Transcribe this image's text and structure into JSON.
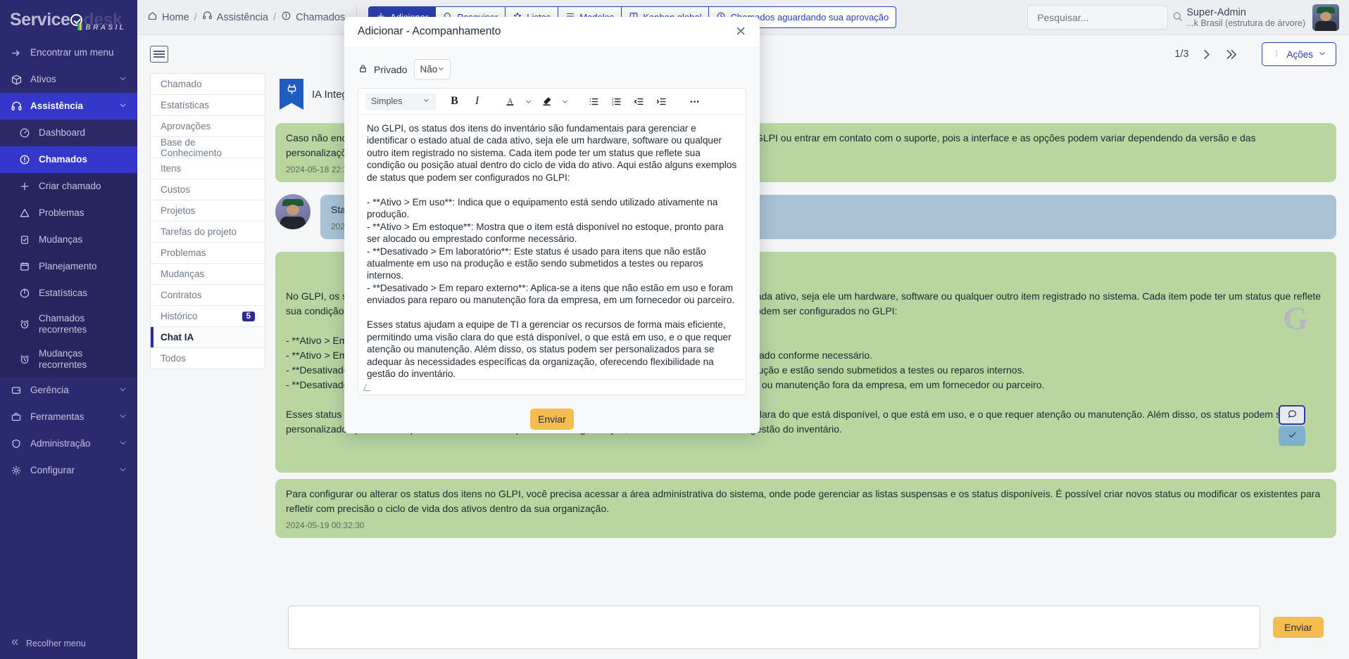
{
  "sidebar": {
    "brand": {
      "part1": "Service",
      "part2": "desk",
      "sub": "BRASIL"
    },
    "find_menu": "Encontrar um menu",
    "groups": [
      {
        "label": "Ativos",
        "icon": "box-icon"
      },
      {
        "label": "Assistência",
        "icon": "headset-icon"
      }
    ],
    "assistance_items": [
      {
        "label": "Dashboard",
        "icon": "gauge-icon"
      },
      {
        "label": "Chamados",
        "icon": "alert-circle-icon"
      },
      {
        "label": "Criar chamado",
        "icon": "plus-icon"
      },
      {
        "label": "Problemas",
        "icon": "warning-triangle-icon"
      },
      {
        "label": "Mudanças",
        "icon": "clipboard-check-icon"
      },
      {
        "label": "Planejamento",
        "icon": "calendar-icon"
      },
      {
        "label": "Estatísticas",
        "icon": "pie-chart-icon"
      },
      {
        "label": "Chamados recorrentes",
        "icon": "alarm-clock-icon"
      },
      {
        "label": "Mudanças recorrentes",
        "icon": "alarm-clock-icon"
      }
    ],
    "bottom_groups": [
      {
        "label": "Gerência",
        "icon": "wallet-icon"
      },
      {
        "label": "Ferramentas",
        "icon": "briefcase-icon"
      },
      {
        "label": "Administração",
        "icon": "shield-icon"
      },
      {
        "label": "Configurar",
        "icon": "gear-icon"
      }
    ],
    "collapse": "Recolher menu"
  },
  "topbar": {
    "breadcrumb": [
      {
        "label": "Home",
        "icon": "home-icon"
      },
      {
        "label": "Assistência",
        "icon": "headset-icon"
      },
      {
        "label": "Chamados",
        "icon": "alert-circle-icon"
      }
    ],
    "buttons": [
      {
        "label": "Adicionar",
        "icon": "plus-icon",
        "primary": true
      },
      {
        "label": "Pesquisar",
        "icon": "search-icon",
        "primary": false
      },
      {
        "label": "Listas",
        "icon": "star-icon",
        "primary": false
      },
      {
        "label": "Modelos",
        "icon": "template-icon",
        "primary": false
      },
      {
        "label": "Kanban global",
        "icon": "kanban-icon",
        "primary": false
      },
      {
        "label": "Chamados aguardando sua aprovação",
        "icon": "clock-icon",
        "primary": false
      }
    ],
    "search_placeholder": "Pesquisar...",
    "search_value": "",
    "user_name": "Super-Admin",
    "user_entity": "...k Brasil (estrutura de árvore)"
  },
  "page": {
    "list_view_icon": "list-view-icon",
    "pagination": "1/3",
    "next_icon": "chevron-right-icon",
    "last_icon": "chevrons-right-icon",
    "actions_label": "Ações",
    "actions_icon": "dots-vertical-icon"
  },
  "subnav": {
    "items": [
      {
        "label": "Chamado"
      },
      {
        "label": "Estatísticas"
      },
      {
        "label": "Aprovações"
      },
      {
        "label": "Base de Conhecimento"
      },
      {
        "label": "Itens"
      },
      {
        "label": "Custos"
      },
      {
        "label": "Projetos"
      },
      {
        "label": "Tarefas do projeto"
      },
      {
        "label": "Problemas"
      },
      {
        "label": "Mudanças"
      },
      {
        "label": "Contratos"
      },
      {
        "label": "Histórico",
        "badge": "5"
      },
      {
        "label": "Chat IA",
        "active": true
      },
      {
        "label": "Todos"
      }
    ]
  },
  "chat": {
    "header_title": "IA Integração",
    "header_icon": "plug-flag-icon",
    "messages": [
      {
        "type": "green",
        "text": "Caso não encontre a opção desejada, pode ser útil consultar a documentação específica da sua versão do GLPI ou entrar em contato com o suporte, pois a interface e as opções podem variar dependendo da versão e das personalizações implementadas.",
        "time": "2024-05-18 22:36:40"
      },
      {
        "type": "blue",
        "text": "Status de itens do inventário",
        "time": "2024-05-19 00:32:11",
        "avatar": "user-avatar"
      },
      {
        "type": "green",
        "text": "No GLPI, os status dos itens do inventário são fundamentais para gerenciar e identificar o estado atual de cada ativo, seja ele um hardware, software ou qualquer outro item registrado no sistema. Cada item pode ter um status que reflete sua condição ou posição atual dentro do ciclo de vida do ativo. Aqui estão alguns exemplos de status que podem ser configurados no GLPI:\n\n- **Ativo > Em uso**: Indica que o equipamento está sendo utilizado ativamente na produção.\n- **Ativo > Em estoque**: Mostra que o item está disponível no estoque, pronto para ser alocado ou emprestado conforme necessário.\n- **Desativado > Em laboratório**: Este status é usado para itens que não estão atualmente em uso na produção e estão sendo submetidos a testes ou reparos internos.\n- **Desativado > Em reparo externo**: Aplica-se a itens que não estão em uso e foram enviados para reparo ou manutenção fora da empresa, em um fornecedor ou parceiro.\n\nEsses status ajudam a equipe de TI a gerenciar os recursos de forma mais eficiente, permitindo uma visão clara do que está disponível, o que está em uso, e o que requer atenção ou manutenção. Além disso, os status podem ser personalizados para se adequar às necessidades específicas da organização, oferecendo flexibilidade na gestão do inventário.",
        "time": ""
      },
      {
        "type": "green",
        "text": "Para configurar ou alterar os status dos itens no GLPI, você precisa acessar a área administrativa do sistema, onde pode gerenciar as listas suspensas e os status disponíveis. É possível criar novos status ou modificar os existentes para refletir com precisão o ciclo de vida dos ativos dentro da sua organização.",
        "time": "2024-05-19 00:32:30"
      }
    ],
    "watermark": "G",
    "float_buttons": [
      {
        "icon": "comment-icon",
        "name": "comment-action"
      },
      {
        "icon": "check-icon",
        "name": "validate-action"
      }
    ],
    "input_placeholder": "",
    "input_value": "",
    "send_label": "Enviar"
  },
  "modal": {
    "title": "Adicionar - Acompanhamento",
    "close_icon": "close-icon",
    "private_label": "Privado",
    "private_icon": "lock-icon",
    "private_value": "Não",
    "editor": {
      "style_value": "Simples",
      "toolbar": [
        {
          "name": "bold-button",
          "glyph": "B"
        },
        {
          "name": "italic-button",
          "glyph": "I"
        },
        {
          "name": "font-color-button",
          "glyph": "A"
        },
        {
          "name": "highlight-color-button",
          "glyph": "pen"
        },
        {
          "name": "bullet-list-button",
          "glyph": "ul"
        },
        {
          "name": "numbered-list-button",
          "glyph": "ol"
        },
        {
          "name": "outdent-button",
          "glyph": "outdent"
        },
        {
          "name": "indent-button",
          "glyph": "indent"
        },
        {
          "name": "more-options-button",
          "glyph": "..."
        }
      ],
      "content": "No GLPI, os status dos itens do inventário são fundamentais para gerenciar e identificar o estado atual de cada ativo, seja ele um hardware, software ou qualquer outro item registrado no sistema. Cada item pode ter um status que reflete sua condição ou posição atual dentro do ciclo de vida do ativo. Aqui estão alguns exemplos de status que podem ser configurados no GLPI:\n\n- **Ativo > Em uso**: Indica que o equipamento está sendo utilizado ativamente na produção.\n- **Ativo > Em estoque**: Mostra que o item está disponível no estoque, pronto para ser alocado ou emprestado conforme necessário.\n- **Desativado > Em laboratório**: Este status é usado para itens que não estão atualmente em uso na produção e estão sendo submetidos a testes ou reparos internos.\n- **Desativado > Em reparo externo**: Aplica-se a itens que não estão em uso e foram enviados para reparo ou manutenção fora da empresa, em um fornecedor ou parceiro.\n\nEsses status ajudam a equipe de TI a gerenciar os recursos de forma mais eficiente, permitindo uma visão clara do que está disponível, o que está em uso, e o que requer atenção ou manutenção. Além disso, os status podem ser personalizados para se adequar às necessidades específicas da organização, oferecendo flexibilidade na gestão do inventário.\n\nPara configurar ou alterar os status dos itens no GLPI, você precisa acessar a área administrativa do sistema, onde pode gerenciar as listas suspensas e os status disponíveis. É possível criar novos status ou modificar os existentes para refletir com precisão o ciclo de vida dos ativos dentro da sua organização."
    },
    "send_label": "Enviar"
  },
  "colors": {
    "sidebar_bg": "#2c2a6e",
    "sidebar_active": "#3437c9",
    "accent_blue": "#2c3dae",
    "send_yellow": "#f5bd4f",
    "bubble_green": "#b9d6a1",
    "bubble_blue": "#a9c2d6"
  }
}
